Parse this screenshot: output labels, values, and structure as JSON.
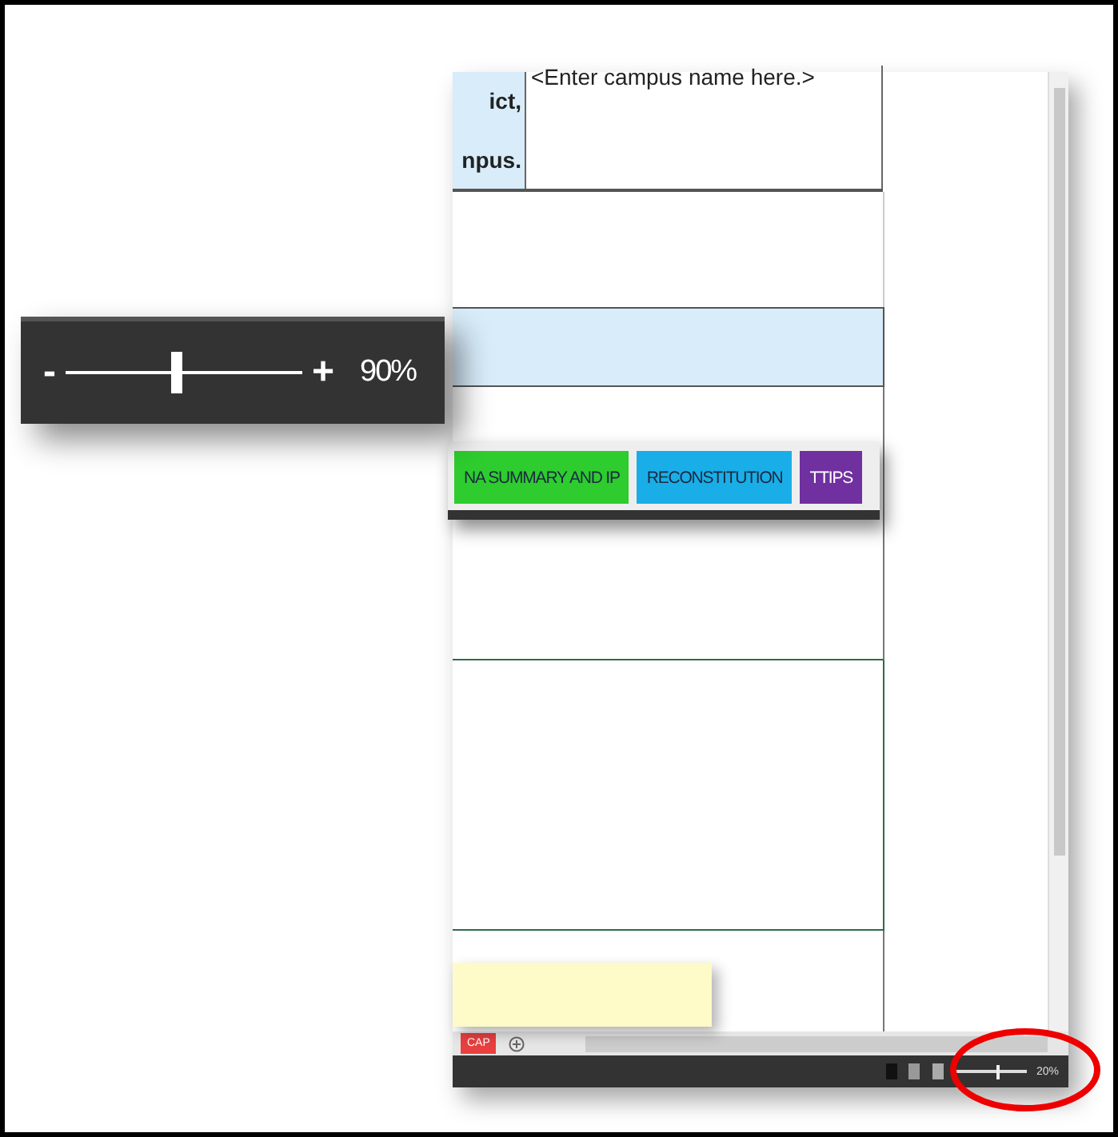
{
  "zoom_callout": {
    "minus": "-",
    "plus": "+",
    "level": 0.47,
    "reading": "90%"
  },
  "sheet": {
    "label_cell": [
      "ict,",
      "npus."
    ],
    "campus_cell": "<Enter campus name here.>"
  },
  "tab_popup": [
    {
      "label": "NA SUMMARY AND IP",
      "color": "#2ecc2e"
    },
    {
      "label": "RECONSTITUTION",
      "color": "#1aaee8"
    },
    {
      "label": "TTIPS",
      "color": "#7030a0"
    }
  ],
  "sheet_tabs": [
    {
      "label": "CAP",
      "color": "#e84040"
    }
  ],
  "status_zoom": {
    "level": 0.6,
    "reading": "20%"
  }
}
